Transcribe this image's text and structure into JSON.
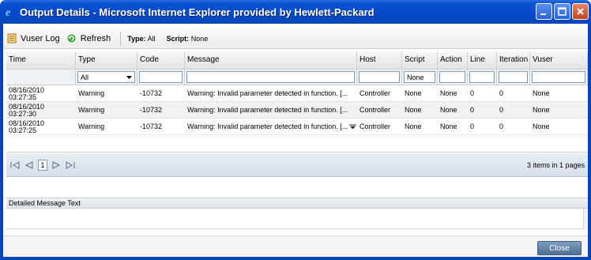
{
  "window": {
    "title": "Output Details - Microsoft Internet Explorer provided by Hewlett-Packard",
    "icon": "ie-icon"
  },
  "toolbar": {
    "vuser_log_label": "Vuser Log",
    "refresh_label": "Refresh",
    "type_label": "Type:",
    "type_value": "All",
    "script_label": "Script:",
    "script_value": "None"
  },
  "grid": {
    "columns": [
      "Time",
      "Type",
      "Code",
      "Message",
      "Host",
      "Script",
      "Action",
      "Line",
      "Iteration",
      "Vuser"
    ],
    "filters": {
      "type_selected": "All",
      "script_value": "None"
    },
    "rows": [
      {
        "time_date": "08/16/2010",
        "time_clock": "03:27:35",
        "type": "Warning",
        "code": "-10732",
        "message": "Warning: Invalid parameter detected in function. [...",
        "host": "Controller",
        "script": "None",
        "action": "None",
        "line": "0",
        "iteration": "0",
        "vuser": "None"
      },
      {
        "time_date": "08/16/2010",
        "time_clock": "03:27:30",
        "type": "Warning",
        "code": "-10732",
        "message": "Warning: Invalid parameter detected in function. [...",
        "host": "Controller",
        "script": "None",
        "action": "None",
        "line": "0",
        "iteration": "0",
        "vuser": "None"
      },
      {
        "time_date": "08/16/2010",
        "time_clock": "03:27:25",
        "type": "Warning",
        "code": "-10732",
        "message": "Warning: Invalid parameter detected in function. [...",
        "host": "Controller",
        "script": "None",
        "action": "None",
        "line": "0",
        "iteration": "0",
        "vuser": "None"
      }
    ]
  },
  "pager": {
    "current_page": "1",
    "info": "3 items in 1 pages"
  },
  "detail": {
    "title": "Detailed Message Text"
  },
  "footer": {
    "close_label": "Close"
  }
}
